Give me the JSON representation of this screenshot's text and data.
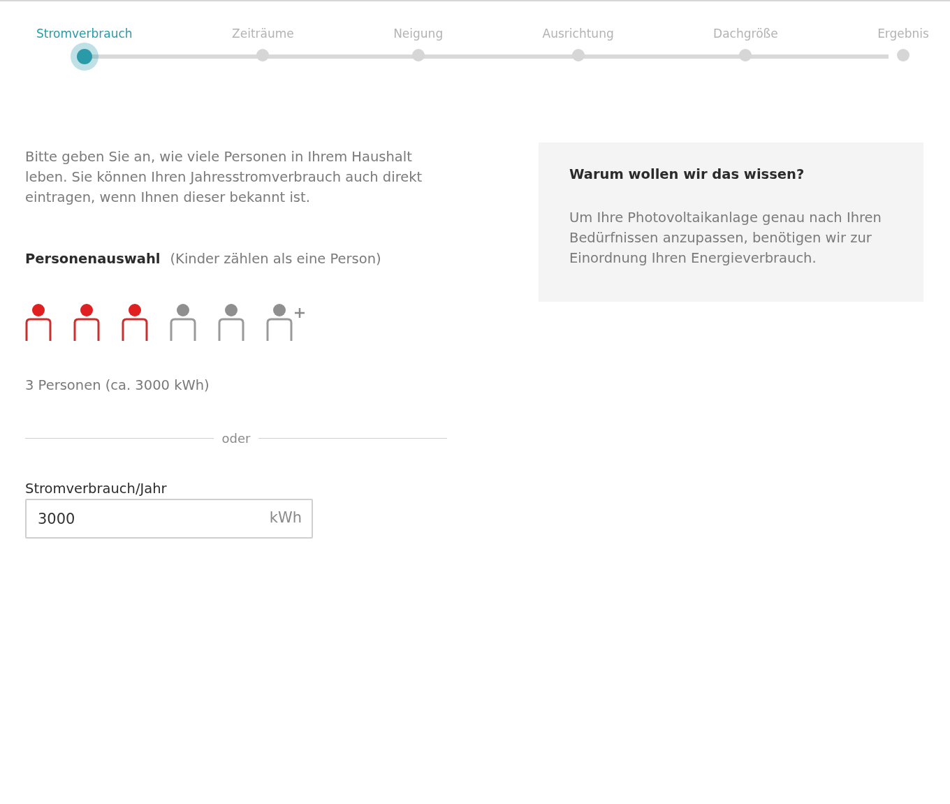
{
  "steps": [
    {
      "label": "Stromverbrauch",
      "selected": true
    },
    {
      "label": "Zeiträume",
      "selected": false
    },
    {
      "label": "Neigung",
      "selected": false
    },
    {
      "label": "Ausrichtung",
      "selected": false
    },
    {
      "label": "Dachgröße",
      "selected": false
    },
    {
      "label": "Ergebnis",
      "selected": false
    }
  ],
  "intro": "Bitte geben Sie an, wie viele Personen in Ihrem Haushalt leben. Sie können Ihren Jahresstromverbrauch auch direkt eintragen, wenn Ihnen dieser bekannt ist.",
  "person_selection": {
    "label": "Personenauswahl",
    "hint": "(Kinder zählen als eine Person)",
    "persons": [
      {
        "kind": "person",
        "selected": true
      },
      {
        "kind": "person",
        "selected": true
      },
      {
        "kind": "person",
        "selected": true
      },
      {
        "kind": "person",
        "selected": false
      },
      {
        "kind": "person",
        "selected": false
      },
      {
        "kind": "more",
        "selected": false
      }
    ],
    "summary": "3 Personen (ca. 3000 kWh)"
  },
  "divider_label": "oder",
  "consumption_field": {
    "label": "Stromverbrauch/Jahr",
    "value": "3000",
    "unit": "kWh"
  },
  "info_box": {
    "title": "Warum wollen wir das wissen?",
    "text": "Um Ihre Photovoltaikanlage genau nach Ihren Bedürfnissen anzupassen, benötigen wir zur Einordnung Ihren Energieverbrauch."
  }
}
